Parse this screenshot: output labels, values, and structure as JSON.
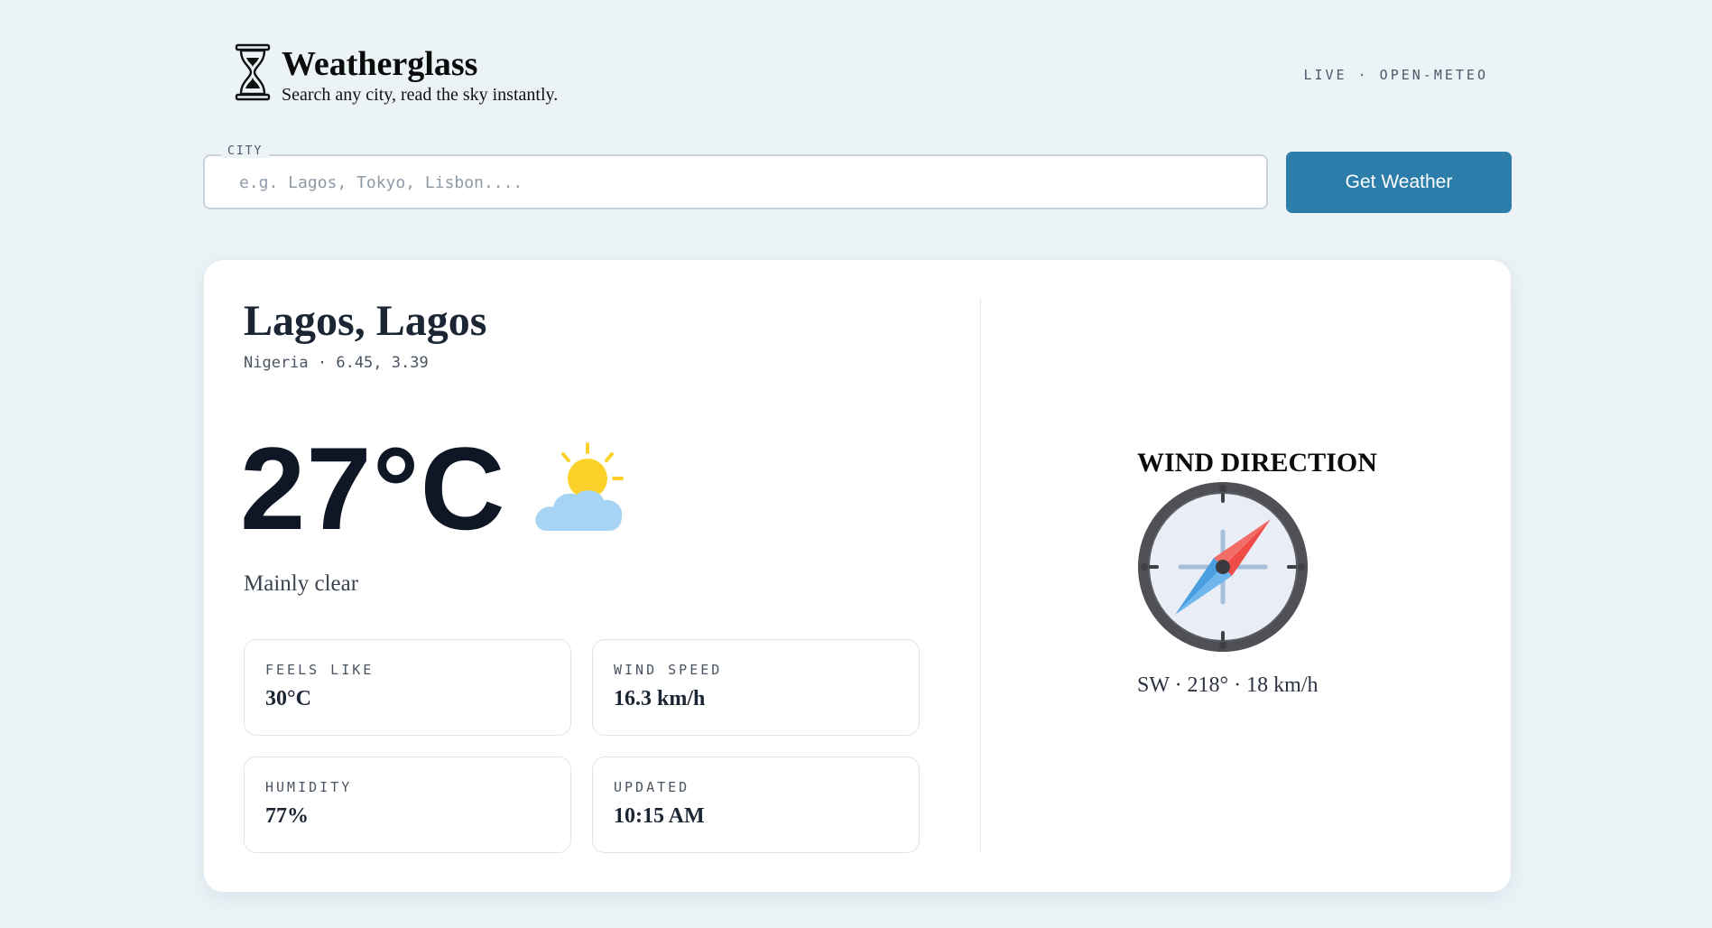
{
  "header": {
    "app_name": "Weatherglass",
    "tagline": "Search any city, read the sky instantly.",
    "source_tag": "LIVE · OPEN-METEO"
  },
  "search": {
    "label": "CITY",
    "placeholder": "e.g. Lagos, Tokyo, Lisbon....",
    "value": "",
    "button_label": "Get Weather"
  },
  "weather": {
    "city": "Lagos, Lagos",
    "location_detail": "Nigeria · 6.45, 3.39",
    "temperature": "27°C",
    "condition": "Mainly clear",
    "condition_icon": "partly-cloudy-icon",
    "stats": {
      "feels_like": {
        "label": "FEELS LIKE",
        "value": "30°C"
      },
      "wind_speed": {
        "label": "WIND SPEED",
        "value": "16.3 km/h"
      },
      "humidity": {
        "label": "HUMIDITY",
        "value": "77%"
      },
      "updated": {
        "label": "UPDATED",
        "value": "10:15 AM"
      }
    }
  },
  "wind": {
    "title": "WIND DIRECTION",
    "readout": "SW · 218° · 18 km/h",
    "icon": "compass-icon"
  },
  "colors": {
    "background": "#ebf3f7",
    "accent": "#2d7dab",
    "card": "#ffffff",
    "sun": "#fcd12a",
    "cloud": "#a7d4f5",
    "needle_north": "#ef4b47",
    "needle_south": "#4a9fe0"
  }
}
